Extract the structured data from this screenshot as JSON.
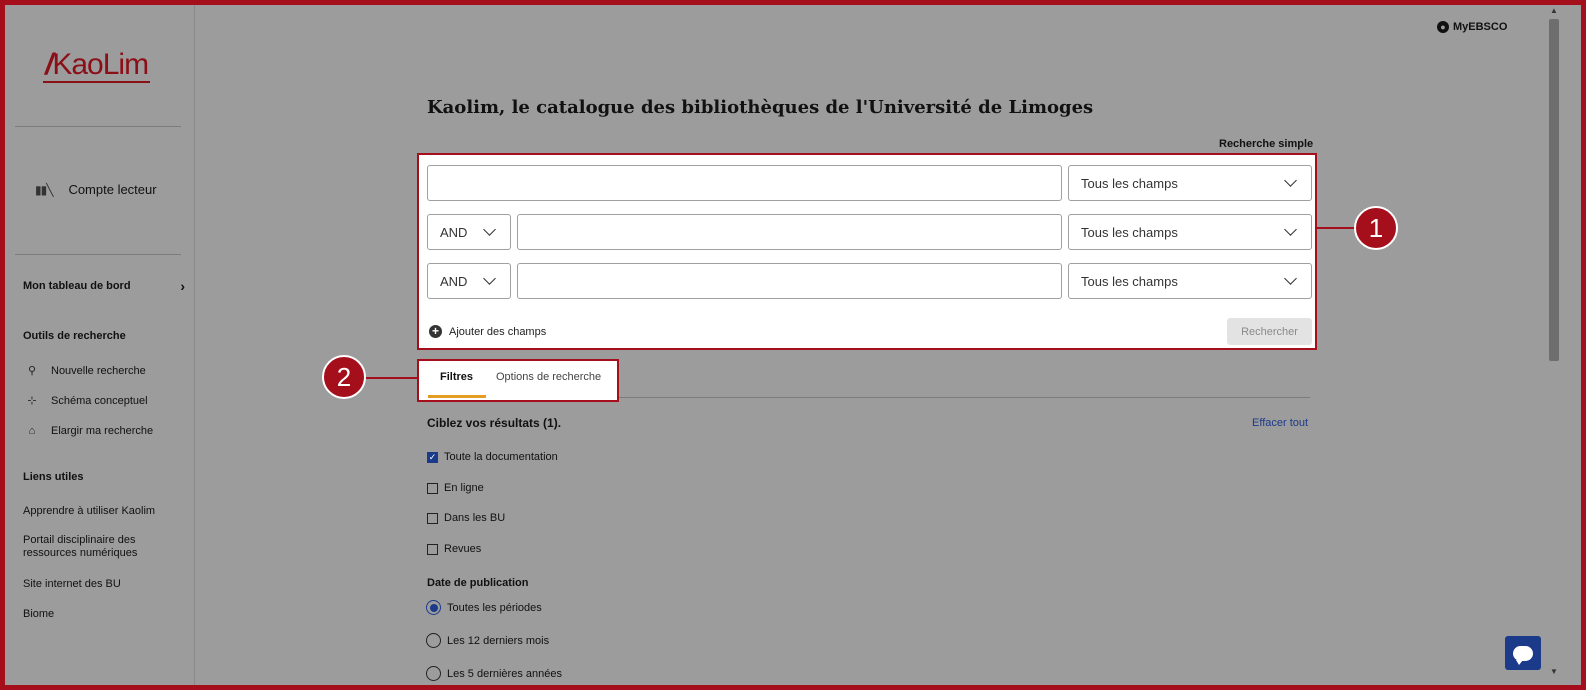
{
  "colors": {
    "accent": "#a50f1c",
    "link": "#1b3a8a",
    "tab_indicator": "#e49d21",
    "overlay_gray": "#9c9c9c"
  },
  "sidebar": {
    "logo_text": "KaoLim",
    "account_label": "Compte lecteur",
    "account_icon": "library-books-icon",
    "dashboard_label": "Mon tableau de bord",
    "tools_heading": "Outils de recherche",
    "tools": [
      {
        "label": "Nouvelle recherche",
        "icon": "search-icon"
      },
      {
        "label": "Schéma conceptuel",
        "icon": "concept-map-icon"
      },
      {
        "label": "Elargir ma recherche",
        "icon": "institution-icon"
      }
    ],
    "links_heading": "Liens utiles",
    "links": [
      {
        "label": "Apprendre à utiliser Kaolim"
      },
      {
        "label": "Portail disciplinaire des ressources numériques"
      },
      {
        "label": "Site internet des BU"
      },
      {
        "label": "Biome"
      }
    ]
  },
  "header": {
    "myebsco_label": "MyEBSCO"
  },
  "main": {
    "title": "Kaolim, le catalogue des bibliothèques de l'Université de Limoges",
    "simple_search_link": "Recherche simple",
    "search_rows": [
      {
        "operator": null,
        "value": "",
        "field": "Tous les champs"
      },
      {
        "operator": "AND",
        "value": "",
        "field": "Tous les champs"
      },
      {
        "operator": "AND",
        "value": "",
        "field": "Tous les champs"
      }
    ],
    "add_fields_label": "Ajouter des champs",
    "search_button_label": "Rechercher",
    "tabs": [
      {
        "label": "Filtres",
        "active": true
      },
      {
        "label": "Options de recherche",
        "active": false
      }
    ],
    "refine_title": "Ciblez vos résultats (1).",
    "clear_all_label": "Effacer tout",
    "checkboxes": [
      {
        "label": "Toute la documentation",
        "checked": true
      },
      {
        "label": "En ligne",
        "checked": false
      },
      {
        "label": "Dans les BU",
        "checked": false
      },
      {
        "label": "Revues",
        "checked": false
      }
    ],
    "date_title": "Date de publication",
    "date_options": [
      {
        "label": "Toutes les périodes",
        "selected": true
      },
      {
        "label": "Les 12 derniers mois",
        "selected": false
      },
      {
        "label": "Les 5 dernières années",
        "selected": false
      }
    ]
  },
  "annotations": {
    "badge_1": "1",
    "badge_2": "2"
  }
}
